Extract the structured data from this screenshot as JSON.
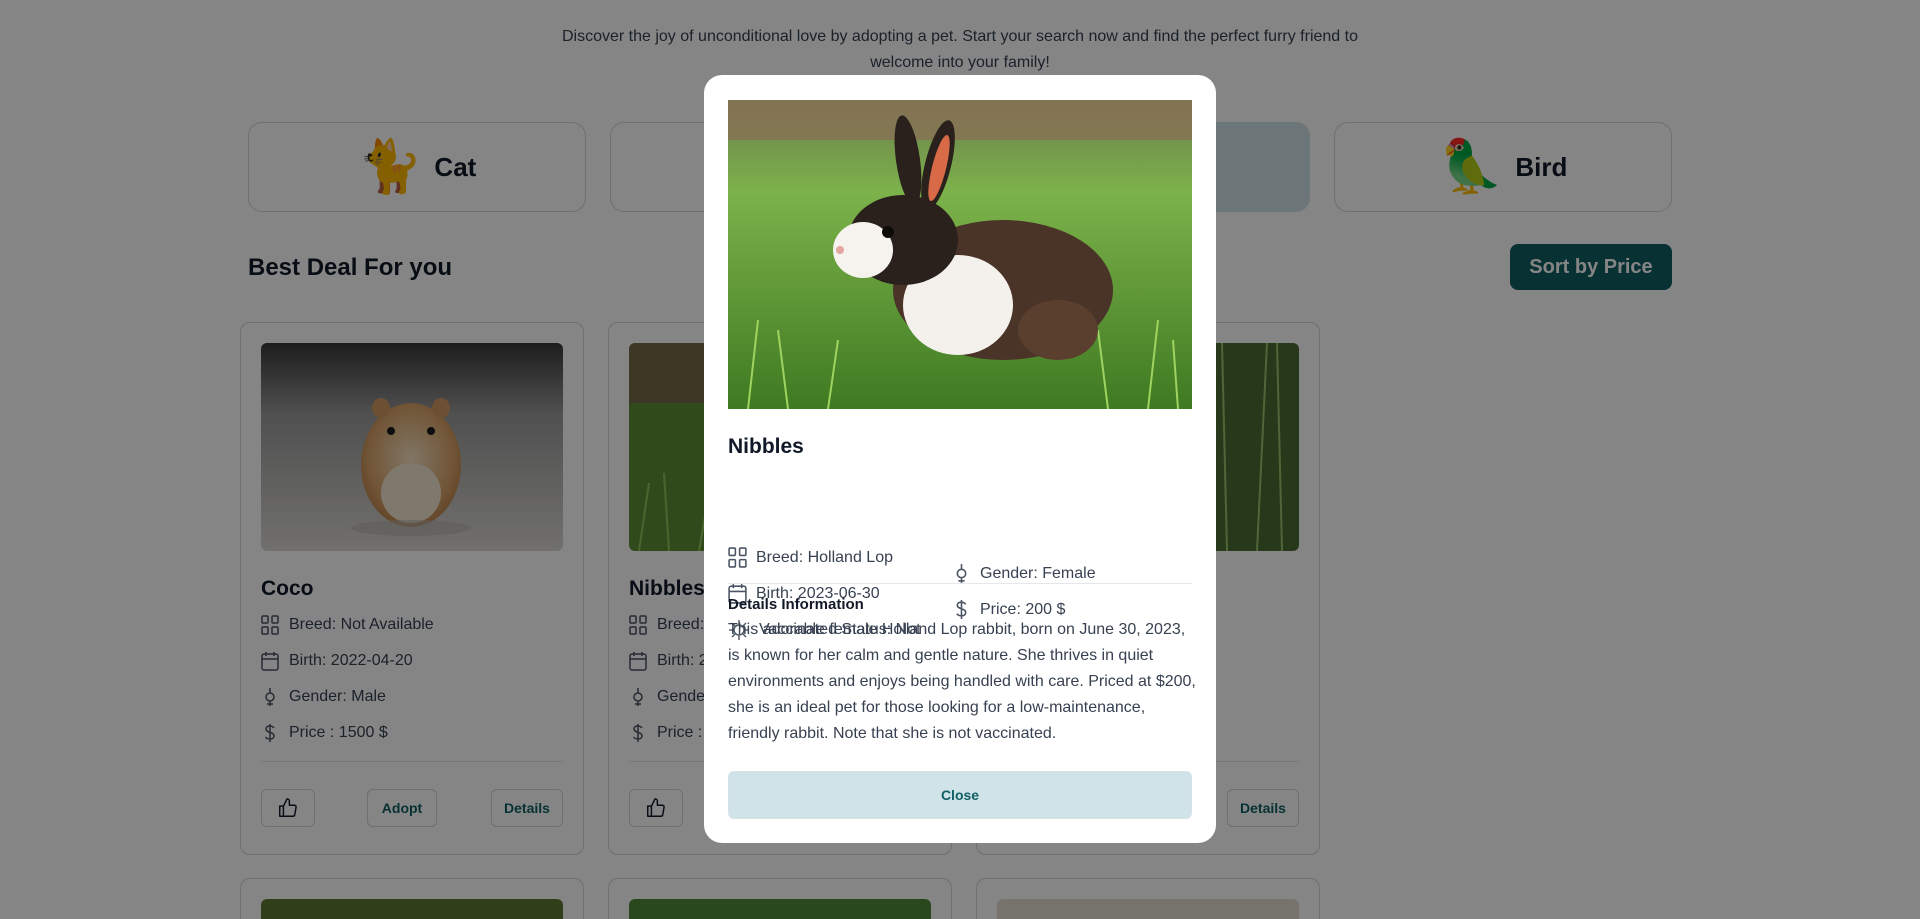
{
  "intro": "Discover the joy of unconditional love by adopting a pet. Start your search now and find the perfect furry friend to welcome into your family!",
  "categories": [
    {
      "label": "Cat",
      "icon": "🐈"
    },
    {
      "label": "",
      "icon": ""
    },
    {
      "label": "",
      "icon": ""
    },
    {
      "label": "Bird",
      "icon": "🦜"
    }
  ],
  "section_title": "Best Deal For you",
  "sort_label": "Sort by Price",
  "cards": [
    {
      "name": "Coco",
      "breed": "Breed: Not Available",
      "birth": "Birth: 2022-04-20",
      "gender": "Gender: Male",
      "price": "Price : 1500 $",
      "adopt_label": "Adopt",
      "details_label": "Details"
    },
    {
      "name": "Nibbles",
      "breed": "Breed:",
      "birth": "Birth: 2",
      "gender": "Gende",
      "price": "Price :",
      "adopt_label": "",
      "details_label": ""
    },
    {
      "name": "",
      "breed": "",
      "birth": "",
      "gender": "",
      "price": "",
      "adopt_label": "",
      "details_label": "Details"
    }
  ],
  "modal": {
    "name": "Nibbles",
    "breed": "Breed: Holland Lop",
    "birth": "Birth: 2023-06-30",
    "vaccinated": "Vaccinated Status: Not",
    "gender": "Gender: Female",
    "price": "Price: 200 $",
    "details_title": "Details Information",
    "details_text": "This adorable female Holland Lop rabbit, born on June 30, 2023, is known for her calm and gentle nature. She thrives in quiet environments and enjoys being handled with care. Priced at $200, she is an ideal pet for those looking for a low-maintenance, friendly rabbit. Note that she is not vaccinated.",
    "close_label": "Close"
  },
  "colors": {
    "accent": "#0f5f63",
    "accent_light": "#cfe3e8",
    "overlay": "rgba(0,0,0,0.48)"
  }
}
